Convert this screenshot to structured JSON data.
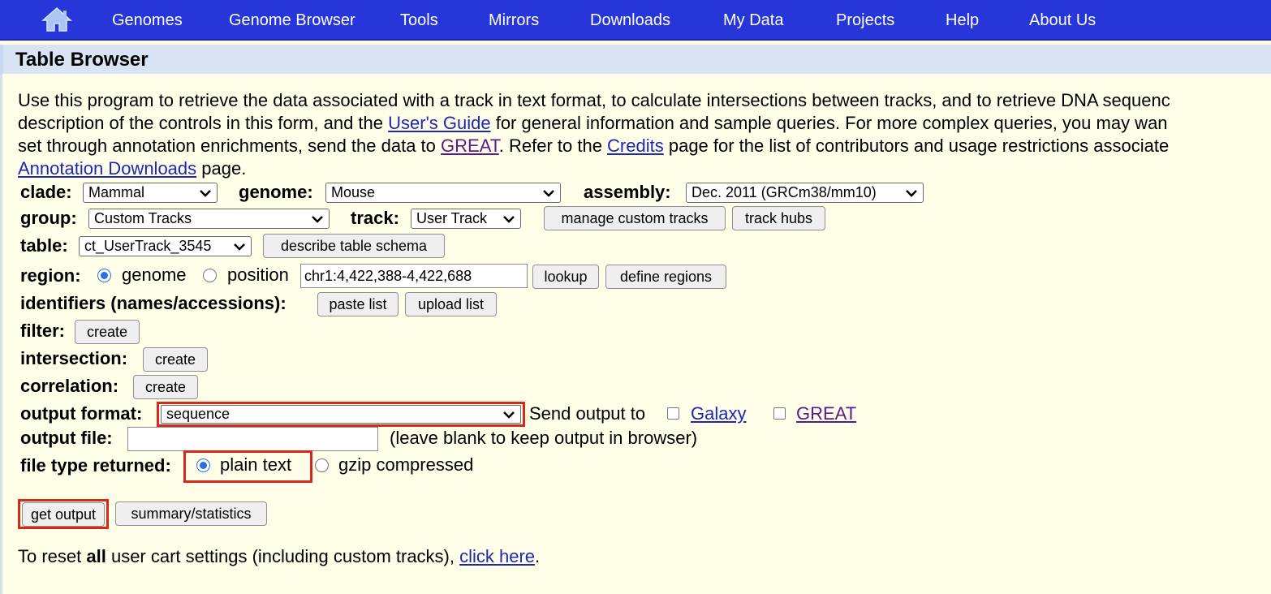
{
  "nav": {
    "home_icon": "home-icon",
    "items": [
      "Genomes",
      "Genome Browser",
      "Tools",
      "Mirrors",
      "Downloads",
      "My Data",
      "Projects",
      "Help",
      "About Us"
    ]
  },
  "title": "Table Browser",
  "intro": {
    "line1": "Use this program to retrieve the data associated with a track in text format, to calculate intersections between tracks, and to retrieve DNA sequenc",
    "line2_a": "description of the controls in this form, and the ",
    "line2_link": "User's Guide",
    "line2_b": " for general information and sample queries. For more complex queries, you may wan",
    "line3_a": "set through annotation enrichments, send the data to ",
    "line3_link1": "GREAT",
    "line3_b": ". Refer to the ",
    "line3_link2": "Credits",
    "line3_c": " page for the list of contributors and usage restrictions associate",
    "line4_link": "Annotation Downloads",
    "line4_b": " page."
  },
  "form": {
    "clade_label": "clade:",
    "clade_value": "Mammal",
    "genome_label": "genome:",
    "genome_value": "Mouse",
    "assembly_label": "assembly:",
    "assembly_value": "Dec. 2011 (GRCm38/mm10)",
    "group_label": "group:",
    "group_value": "Custom Tracks",
    "track_label": "track:",
    "track_value": "User Track",
    "manage_button": "manage custom tracks",
    "track_hubs_button": "track hubs",
    "table_label": "table:",
    "table_value": "ct_UserTrack_3545",
    "describe_button": "describe table schema",
    "region_label": "region:",
    "region_genome": "genome",
    "region_position": "position",
    "position_value": "chr1:4,422,388-4,422,688",
    "lookup_button": "lookup",
    "define_regions_button": "define regions",
    "identifiers_label": "identifiers (names/accessions):",
    "paste_list_button": "paste list",
    "upload_list_button": "upload list",
    "filter_label": "filter:",
    "intersection_label": "intersection:",
    "correlation_label": "correlation:",
    "create_button": "create",
    "output_format_label": "output format:",
    "output_format_value": "sequence",
    "send_output_to": "Send output to",
    "galaxy_link": "Galaxy",
    "great_link": "GREAT",
    "output_file_label": "output file:",
    "output_file_value": "",
    "output_file_hint": "(leave blank to keep output in browser)",
    "file_type_label": "file type returned:",
    "plain_text": "plain text",
    "gzip_compressed": "gzip compressed",
    "get_output_button": "get output",
    "summary_button": "summary/statistics"
  },
  "reset": {
    "text_a": "To reset ",
    "text_bold": "all",
    "text_b": " user cart settings (including custom tracks), ",
    "link": "click here",
    "text_c": "."
  },
  "colors": {
    "nav_bg": "#2636d8",
    "page_bg": "#fffee8",
    "title_bg": "#d8e4f4",
    "highlight": "#d8281c",
    "link": "#1c28b6"
  }
}
